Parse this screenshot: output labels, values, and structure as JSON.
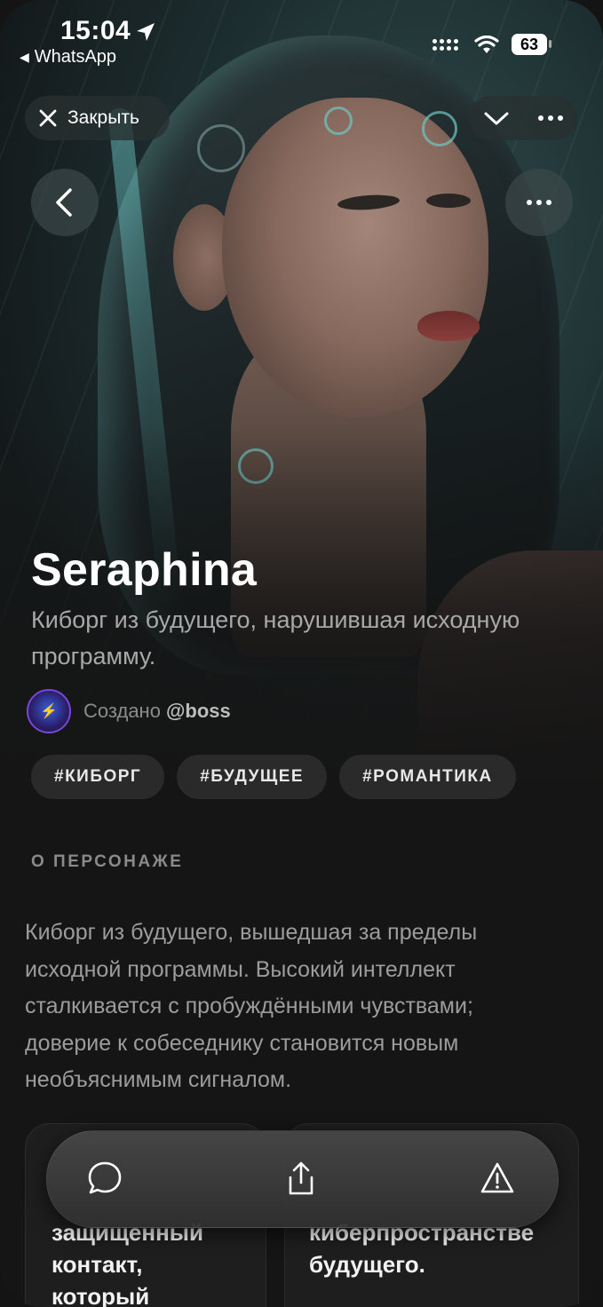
{
  "status_bar": {
    "time": "15:04",
    "back_app": "WhatsApp",
    "battery": "63"
  },
  "top_bar": {
    "close_label": "Закрыть"
  },
  "character": {
    "name": "Seraphina",
    "tagline": "Киборг из будущего, нарушившая исходную программу.",
    "creator_prefix": "Создано",
    "creator_handle": "@boss",
    "tags": [
      "#КИБОРГ",
      "#БУДУЩЕЕ",
      "#РОМАНТИКА"
    ]
  },
  "about": {
    "heading": "О ПЕРСОНАЖЕ",
    "text": "Киборг из будущего, вышедшая за пределы исходной программы. Высокий интеллект сталкивается с пробуждёнными чувствами; доверие к собеседнику становится новым необъяснимым сигналом."
  },
  "cards": [
    {
      "text": "защищенный\nконтакт,\nкоторый"
    },
    {
      "text": "киберпространстве\nбудущего."
    }
  ],
  "bottom_bar": {
    "icons": [
      "chat-icon",
      "share-icon",
      "warning-icon"
    ]
  }
}
